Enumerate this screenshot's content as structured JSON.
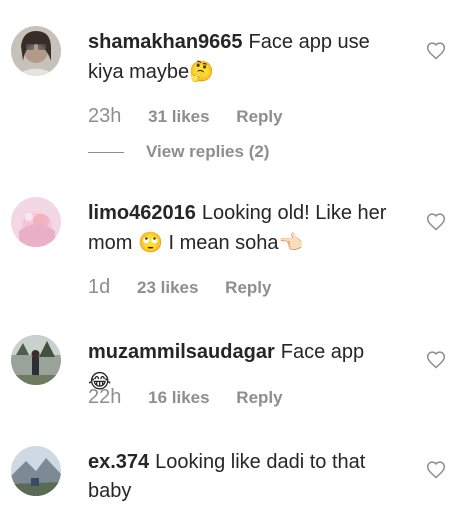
{
  "comments": [
    {
      "username": "shamakhan9665",
      "text": "Face app use kiya maybe",
      "emoji_after": "🤔",
      "time": "23h",
      "likes": "31 likes",
      "reply": "Reply",
      "view_replies": "View replies (2)"
    },
    {
      "username": "limo462016",
      "text_part1": "Looking old! Like her mom",
      "emoji_mid": "🙄",
      "text_part2": "I mean soha",
      "emoji_after": "👈🏻",
      "time": "1d",
      "likes": "23 likes",
      "reply": "Reply"
    },
    {
      "username": "muzammilsaudagar",
      "text": "Face app",
      "emoji_after": "😂",
      "time": "22h",
      "likes": "16 likes",
      "reply": "Reply"
    },
    {
      "username": "ex.374",
      "text": "Looking like dadi to that baby"
    }
  ],
  "icons": {
    "like": "heart-outline-icon"
  },
  "colors": {
    "text": "#262626",
    "meta": "#8e8e8e",
    "background": "#ffffff"
  }
}
